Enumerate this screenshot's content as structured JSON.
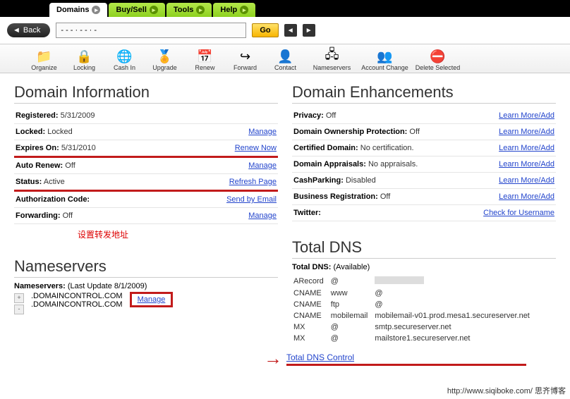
{
  "tabs": {
    "t0": "Domains",
    "t1": "Buy/Sell",
    "t2": "Tools",
    "t3": "Help"
  },
  "back": {
    "label": "Back",
    "go": "Go",
    "url": "- - - · - - · -"
  },
  "toolbar": {
    "organize": "Organize",
    "locking": "Locking",
    "cash": "Cash In",
    "upgrade": "Upgrade",
    "renew": "Renew",
    "forward": "Forward",
    "contact": "Contact",
    "ns": "Nameservers",
    "ac": "Account Change",
    "del": "Delete Selected"
  },
  "left": {
    "title": "Domain Information",
    "rows": [
      {
        "k": "Registered:",
        "v": "5/31/2009",
        "a": ""
      },
      {
        "k": "Locked:",
        "v": "Locked",
        "a": "Manage"
      },
      {
        "k": "Expires On:",
        "v": "5/31/2010",
        "a": "Renew Now"
      },
      {
        "k": "Auto Renew:",
        "v": "Off",
        "a": "Manage"
      },
      {
        "k": "Status:",
        "v": "Active",
        "a": "Refresh Page"
      },
      {
        "k": "Authorization Code:",
        "v": "",
        "a": "Send by Email"
      },
      {
        "k": "Forwarding:",
        "v": "Off",
        "a": "Manage"
      }
    ],
    "anno": "设置转发地址"
  },
  "right": {
    "title": "Domain Enhancements",
    "rows": [
      {
        "k": "Privacy:",
        "v": "Off",
        "a": "Learn More/Add"
      },
      {
        "k": "Domain Ownership Protection:",
        "v": "Off",
        "a": "Learn More/Add"
      },
      {
        "k": "Certified Domain:",
        "v": "No certification.",
        "a": "Learn More/Add"
      },
      {
        "k": "Domain Appraisals:",
        "v": "No appraisals.",
        "a": "Learn More/Add"
      },
      {
        "k": "CashParking:",
        "v": "Disabled",
        "a": "Learn More/Add"
      },
      {
        "k": "Business Registration:",
        "v": "Off",
        "a": "Learn More/Add"
      },
      {
        "k": "Twitter:",
        "v": "",
        "a": "Check for Username"
      }
    ]
  },
  "ns": {
    "title": "Nameservers",
    "label": "Nameservers:",
    "update": "(Last Update 8/1/2009)",
    "s1": ".DOMAINCONTROL.COM",
    "s2": ".DOMAINCONTROL.COM",
    "manage": "Manage"
  },
  "dns": {
    "title": "Total DNS",
    "head": "Total DNS:",
    "avail": "(Available)",
    "rows": [
      [
        "ARecord",
        "@",
        ""
      ],
      [
        "CNAME",
        "www",
        "@"
      ],
      [
        "CNAME",
        "ftp",
        "@"
      ],
      [
        "CNAME",
        "mobilemail",
        "mobilemail-v01.prod.mesa1.secureserver.net"
      ],
      [
        "MX",
        "@",
        "smtp.secureserver.net"
      ],
      [
        "MX",
        "@",
        "mailstore1.secureserver.net"
      ]
    ],
    "link": "Total DNS Control"
  },
  "foot": "http://www.siqiboke.com/  思齐博客"
}
